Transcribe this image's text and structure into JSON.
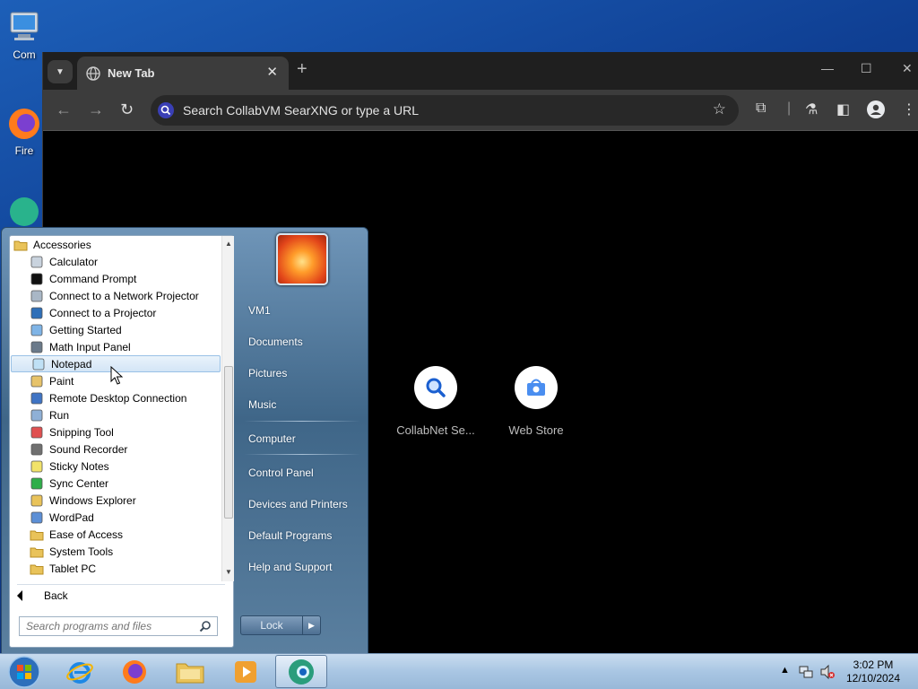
{
  "desktop": {
    "icons": [
      {
        "label": "Com"
      },
      {
        "label": "Fire"
      }
    ]
  },
  "browser": {
    "tab_title": "New Tab",
    "tab_close": "✕",
    "new_tab": "+",
    "omnibox_placeholder": "Search CollabVM SearXNG or type a URL",
    "shortcuts": [
      {
        "label": "CollabNet Se..."
      },
      {
        "label": "Web Store"
      }
    ]
  },
  "start_menu": {
    "folder": "Accessories",
    "programs": [
      {
        "label": "Calculator",
        "icon": "calculator-icon"
      },
      {
        "label": "Command Prompt",
        "icon": "command-prompt-icon"
      },
      {
        "label": "Connect to a Network Projector",
        "icon": "network-projector-icon"
      },
      {
        "label": "Connect to a Projector",
        "icon": "projector-icon"
      },
      {
        "label": "Getting Started",
        "icon": "getting-started-icon"
      },
      {
        "label": "Math Input Panel",
        "icon": "math-input-icon"
      },
      {
        "label": "Notepad",
        "icon": "notepad-icon",
        "highlighted": true
      },
      {
        "label": "Paint",
        "icon": "paint-icon"
      },
      {
        "label": "Remote Desktop Connection",
        "icon": "remote-desktop-icon"
      },
      {
        "label": "Run",
        "icon": "run-icon"
      },
      {
        "label": "Snipping Tool",
        "icon": "snipping-tool-icon"
      },
      {
        "label": "Sound Recorder",
        "icon": "microphone-icon"
      },
      {
        "label": "Sticky Notes",
        "icon": "sticky-notes-icon"
      },
      {
        "label": "Sync Center",
        "icon": "sync-icon"
      },
      {
        "label": "Windows Explorer",
        "icon": "explorer-icon"
      },
      {
        "label": "WordPad",
        "icon": "wordpad-icon"
      },
      {
        "label": "Ease of Access",
        "icon": "folder-icon"
      },
      {
        "label": "System Tools",
        "icon": "folder-icon"
      },
      {
        "label": "Tablet PC",
        "icon": "folder-icon"
      }
    ],
    "back": "Back",
    "search_placeholder": "Search programs and files",
    "right_links": [
      "VM1",
      "Documents",
      "Pictures",
      "Music",
      "Computer",
      "Control Panel",
      "Devices and Printers",
      "Default Programs",
      "Help and Support"
    ],
    "lock": "Lock"
  },
  "taskbar": {
    "time": "3:02 PM",
    "date": "12/10/2024"
  },
  "colors": {
    "highlight": "#d3e5f6",
    "desktop": "#0f3f93"
  }
}
